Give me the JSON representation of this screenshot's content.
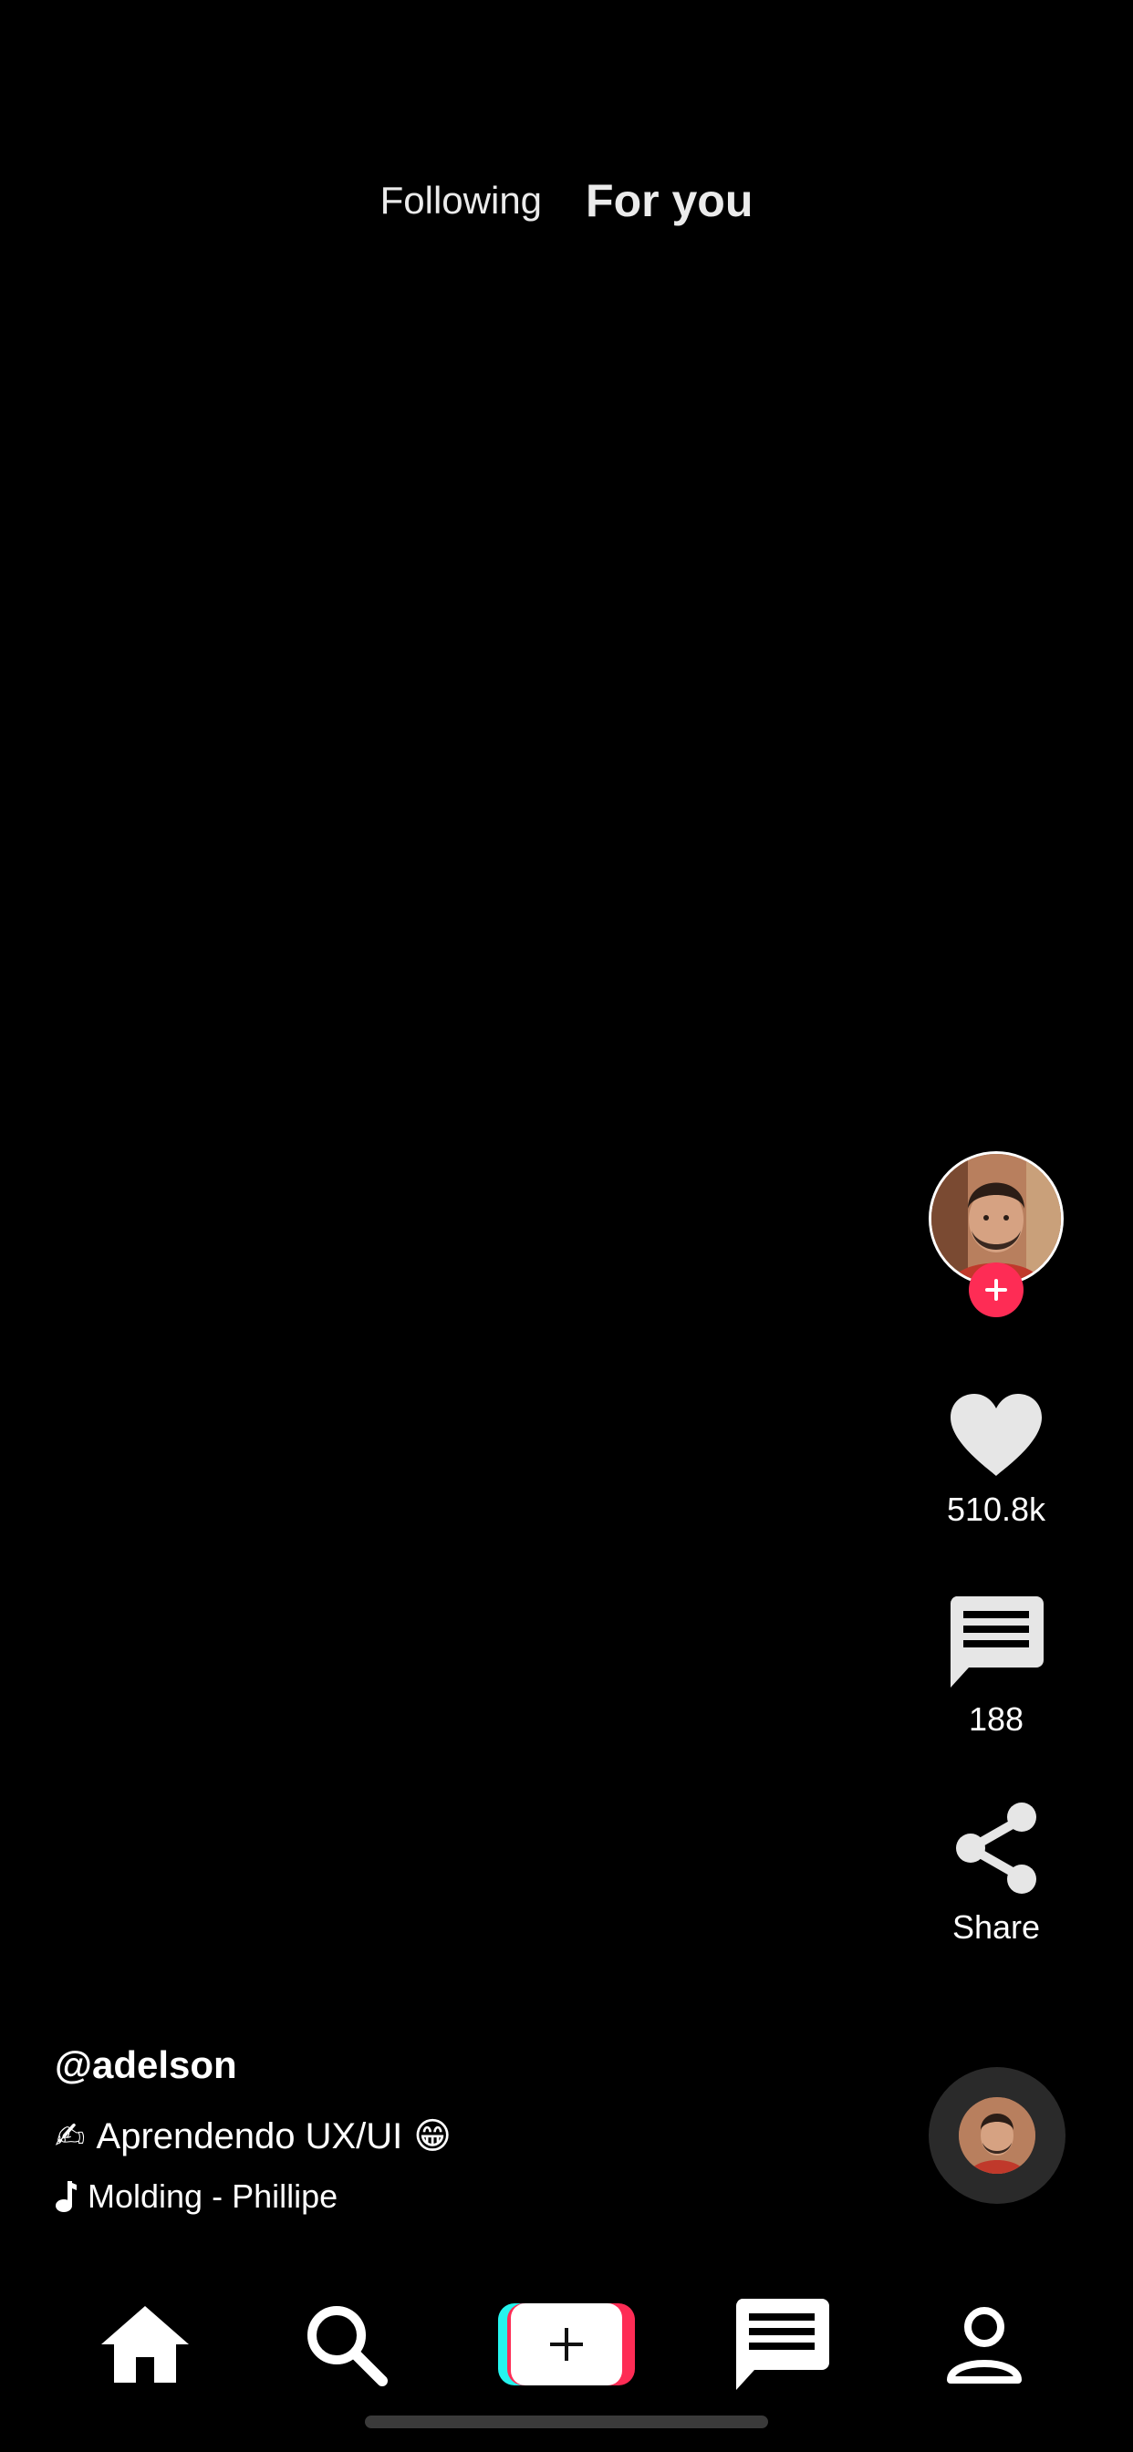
{
  "top_tabs": {
    "following": "Following",
    "for_you": "For you",
    "active": "For you"
  },
  "actions": {
    "likes": "510.8k",
    "comments": "188",
    "share": "Share"
  },
  "caption": {
    "username": "@adelson",
    "description_prefix_emoji": "✍",
    "description_text": "Aprendendo UX/UI",
    "description_suffix_emoji": "😁",
    "music": "Molding - Phillipe"
  },
  "colors": {
    "background": "#000000",
    "accent_red": "#fe2c55",
    "accent_cyan": "#25f4ee",
    "icon_light": "#e6e6e6"
  },
  "icons": {
    "creator_avatar": "avatar",
    "follow": "plus-icon",
    "like": "heart-icon",
    "comment": "comment-icon",
    "share": "share-icon",
    "music": "music-note-icon",
    "record": "spinning-record",
    "home": "home-icon",
    "search": "search-icon",
    "create": "create-icon",
    "inbox": "inbox-icon",
    "profile": "profile-icon"
  }
}
